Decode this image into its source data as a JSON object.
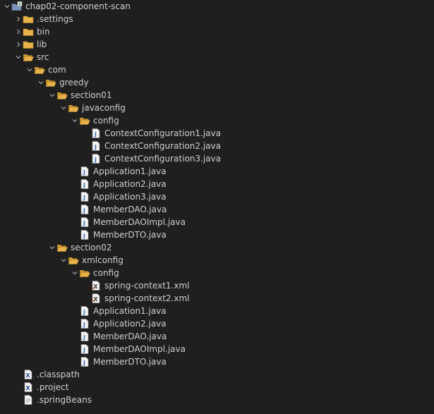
{
  "tree": [
    {
      "label": "chap02-component-scan",
      "depth": 0,
      "icon": "project",
      "arrow": "down"
    },
    {
      "label": ".settings",
      "depth": 1,
      "icon": "folder",
      "arrow": "right"
    },
    {
      "label": "bin",
      "depth": 1,
      "icon": "folder",
      "arrow": "right"
    },
    {
      "label": "lib",
      "depth": 1,
      "icon": "folder",
      "arrow": "right"
    },
    {
      "label": "src",
      "depth": 1,
      "icon": "folder-open",
      "arrow": "down"
    },
    {
      "label": "com",
      "depth": 2,
      "icon": "folder-open",
      "arrow": "down"
    },
    {
      "label": "greedy",
      "depth": 3,
      "icon": "folder-open",
      "arrow": "down"
    },
    {
      "label": "section01",
      "depth": 4,
      "icon": "folder-open",
      "arrow": "down"
    },
    {
      "label": "javaconfig",
      "depth": 5,
      "icon": "folder-open",
      "arrow": "down"
    },
    {
      "label": "config",
      "depth": 6,
      "icon": "folder-open",
      "arrow": "down"
    },
    {
      "label": "ContextConfiguration1.java",
      "depth": 7,
      "icon": "java",
      "arrow": "none"
    },
    {
      "label": "ContextConfiguration2.java",
      "depth": 7,
      "icon": "java",
      "arrow": "none"
    },
    {
      "label": "ContextConfiguration3.java",
      "depth": 7,
      "icon": "java",
      "arrow": "none"
    },
    {
      "label": "Application1.java",
      "depth": 6,
      "icon": "java",
      "arrow": "none"
    },
    {
      "label": "Application2.java",
      "depth": 6,
      "icon": "java",
      "arrow": "none"
    },
    {
      "label": "Application3.java",
      "depth": 6,
      "icon": "java",
      "arrow": "none"
    },
    {
      "label": "MemberDAO.java",
      "depth": 6,
      "icon": "java",
      "arrow": "none"
    },
    {
      "label": "MemberDAOImpl.java",
      "depth": 6,
      "icon": "java",
      "arrow": "none"
    },
    {
      "label": "MemberDTO.java",
      "depth": 6,
      "icon": "java",
      "arrow": "none"
    },
    {
      "label": "section02",
      "depth": 4,
      "icon": "folder-open",
      "arrow": "down"
    },
    {
      "label": "xmlconfig",
      "depth": 5,
      "icon": "folder-open",
      "arrow": "down"
    },
    {
      "label": "config",
      "depth": 6,
      "icon": "folder-open",
      "arrow": "down"
    },
    {
      "label": "spring-context1.xml",
      "depth": 7,
      "icon": "xml",
      "arrow": "none"
    },
    {
      "label": "spring-context2.xml",
      "depth": 7,
      "icon": "xml",
      "arrow": "none"
    },
    {
      "label": "Application1.java",
      "depth": 6,
      "icon": "java",
      "arrow": "none"
    },
    {
      "label": "Application2.java",
      "depth": 6,
      "icon": "java",
      "arrow": "none"
    },
    {
      "label": "MemberDAO.java",
      "depth": 6,
      "icon": "java",
      "arrow": "none"
    },
    {
      "label": "MemberDAOImpl.java",
      "depth": 6,
      "icon": "java",
      "arrow": "none"
    },
    {
      "label": "MemberDTO.java",
      "depth": 6,
      "icon": "java",
      "arrow": "none"
    },
    {
      "label": ".classpath",
      "depth": 1,
      "icon": "xml-file",
      "arrow": "none"
    },
    {
      "label": ".project",
      "depth": 1,
      "icon": "xml-file",
      "arrow": "none"
    },
    {
      "label": ".springBeans",
      "depth": 1,
      "icon": "text-file",
      "arrow": "none"
    }
  ],
  "colors": {
    "background": "#1f1f1f",
    "text": "#cfcfcf",
    "folder": "#e8b34a",
    "java_accent": "#3d6fb5",
    "arrow": "#a8a8a8"
  }
}
